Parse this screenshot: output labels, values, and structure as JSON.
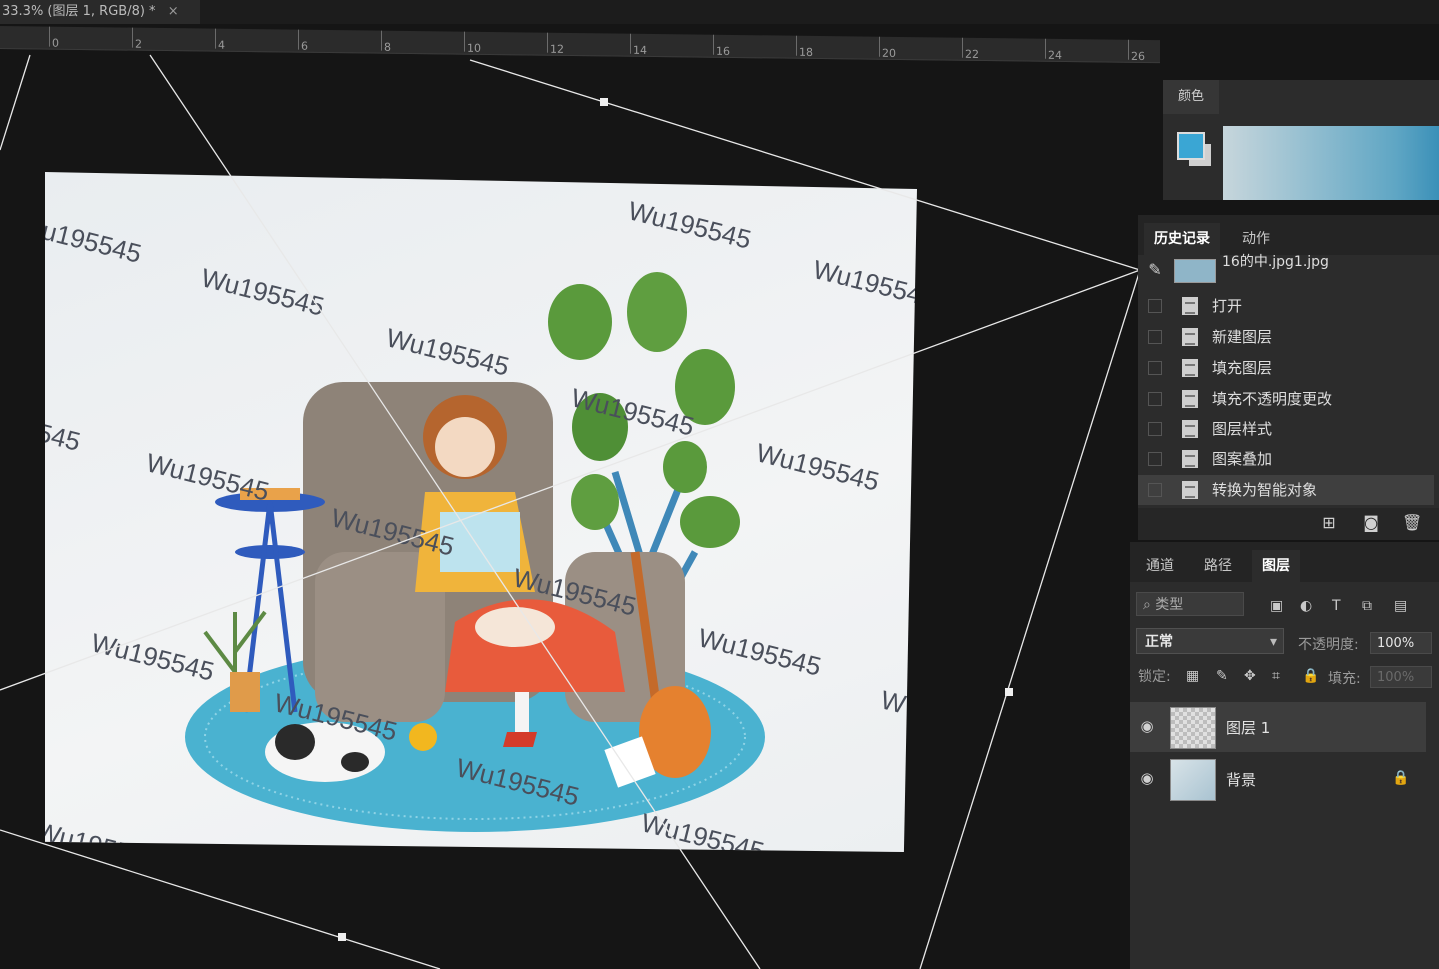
{
  "document": {
    "tab_title": "33.3% (图层 1, RGB/8) *",
    "close_glyph": "×"
  },
  "ruler": {
    "ticks": [
      "0",
      "2",
      "4",
      "6",
      "8",
      "10",
      "12",
      "14",
      "16",
      "18",
      "20",
      "22",
      "24",
      "26"
    ]
  },
  "canvas": {
    "watermark": "Wu195545",
    "watermark_partials": [
      "u195545",
      "545",
      "Wu19554",
      "Wu1955",
      "545",
      "W"
    ]
  },
  "color_panel": {
    "tab_label": "颜色",
    "foreground_color": "#3aa6d4",
    "background_color": "#cfcfcf"
  },
  "history_panel": {
    "tabs": [
      "历史记录",
      "动作"
    ],
    "snapshot_label": "16的中.jpg1.jpg",
    "items": [
      "打开",
      "新建图层",
      "填充图层",
      "填充不透明度更改",
      "图层样式",
      "图案叠加",
      "转换为智能对象"
    ]
  },
  "layers_panel": {
    "tabs": [
      "通道",
      "路径",
      "图层"
    ],
    "filter_placeholder": "类型",
    "blend_mode": "正常",
    "opacity_label": "不透明度:",
    "opacity_value": "100%",
    "lock_label": "锁定:",
    "fill_label": "填充:",
    "fill_value": "100%",
    "layers": [
      {
        "name": "图层 1"
      },
      {
        "name": "背景"
      }
    ]
  },
  "icons": {
    "search": "⌕",
    "eye": "◉",
    "lock": "🔒",
    "camera": "◙",
    "trash": "🗑",
    "new_doc": "⊞"
  }
}
